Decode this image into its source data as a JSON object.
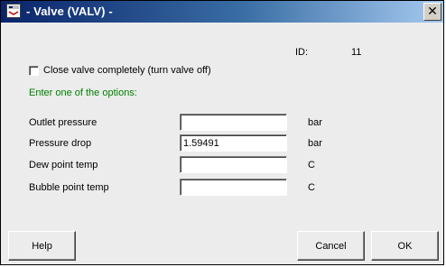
{
  "window": {
    "title": "- Valve (VALV) -",
    "close_glyph": "✕"
  },
  "id": {
    "label": "ID:",
    "value": "11"
  },
  "close_valve": {
    "label": "Close valve completely (turn valve off)",
    "checked": false
  },
  "instruction": "Enter one of the options:",
  "fields": [
    {
      "label": "Outlet pressure",
      "value": "",
      "unit": "bar"
    },
    {
      "label": "Pressure drop",
      "value": "1.59491",
      "unit": "bar"
    },
    {
      "label": "Dew point temp",
      "value": "",
      "unit": "C"
    },
    {
      "label": "Bubble point temp",
      "value": "",
      "unit": "C"
    }
  ],
  "buttons": {
    "help": "Help",
    "cancel": "Cancel",
    "ok": "OK"
  },
  "colors": {
    "instruction_text": "#008000",
    "titlebar_start": "#0a246a",
    "titlebar_end": "#a6caf0"
  },
  "icons": {
    "app": "valve-app-icon",
    "close": "close-icon"
  }
}
